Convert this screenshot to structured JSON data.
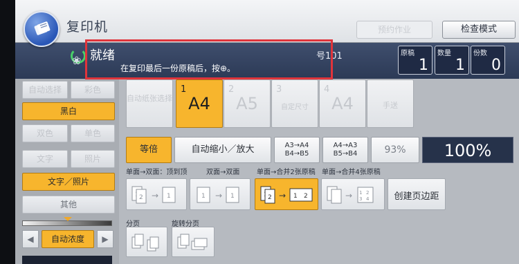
{
  "header": {
    "app_title": "复印机",
    "disabled_button_label": "预约作业",
    "check_mode_label": "检查模式"
  },
  "status": {
    "title": "就绪",
    "message": "在复印最后一份原稿后，按⊕。",
    "job_id": "号101",
    "counters": [
      {
        "label": "原稿",
        "value": "1"
      },
      {
        "label": "数量",
        "value": "1"
      },
      {
        "label": "份数",
        "value": "0"
      }
    ]
  },
  "left_panel": {
    "auto_select": "自动选择",
    "color": "彩色",
    "black_white": "黑白",
    "two_color": "双色",
    "single_color": "单色",
    "text": "文字",
    "photo": "照片",
    "text_photo": "文字／照片",
    "other": "其他",
    "auto_density": "自动浓度"
  },
  "trays": [
    {
      "num": "1",
      "size": "A4",
      "sub": "",
      "selected": true
    },
    {
      "num": "2",
      "size": "A5",
      "sub": "",
      "selected": false
    },
    {
      "num": "3",
      "size": "",
      "sub": "自定尺寸",
      "selected": false
    },
    {
      "num": "4",
      "size": "A4",
      "sub": "",
      "selected": false
    }
  ],
  "auto_paper_label": "自动纸张选择",
  "bypass_label": "手送",
  "zoom": {
    "full_size": "等倍",
    "auto_reduce_enlarge": "自动缩小／放大",
    "reduce_line1": "A3→A4",
    "reduce_line2": "B4→B5",
    "enlarge_line1": "A4→A3",
    "enlarge_line2": "B5→B4",
    "preset": "93%",
    "display": "100%"
  },
  "duplex": {
    "label_1": "单面→双面：顶到顶",
    "label_2": "双面→双面",
    "label_3": "单面→合并2张原稿",
    "label_4": "单面→合并4张原稿",
    "create_margin": "创建页边距"
  },
  "finishing": {
    "sort_label": "分页",
    "rotate_sort_label": "旋转分页"
  }
}
